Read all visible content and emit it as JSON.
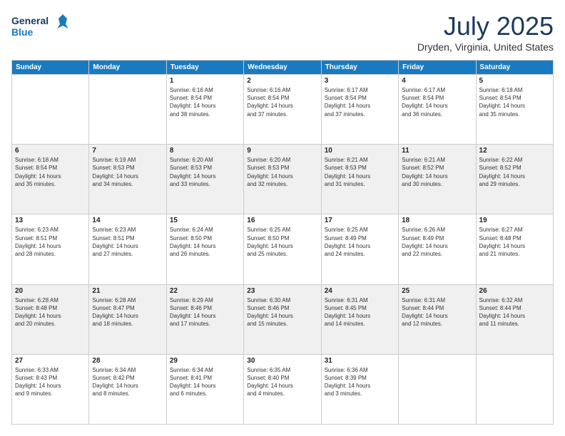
{
  "header": {
    "logo_line1": "General",
    "logo_line2": "Blue",
    "month_year": "July 2025",
    "location": "Dryden, Virginia, United States"
  },
  "weekdays": [
    "Sunday",
    "Monday",
    "Tuesday",
    "Wednesday",
    "Thursday",
    "Friday",
    "Saturday"
  ],
  "weeks": [
    [
      {
        "day": "",
        "info": ""
      },
      {
        "day": "",
        "info": ""
      },
      {
        "day": "1",
        "info": "Sunrise: 6:16 AM\nSunset: 8:54 PM\nDaylight: 14 hours\nand 38 minutes."
      },
      {
        "day": "2",
        "info": "Sunrise: 6:16 AM\nSunset: 8:54 PM\nDaylight: 14 hours\nand 37 minutes."
      },
      {
        "day": "3",
        "info": "Sunrise: 6:17 AM\nSunset: 8:54 PM\nDaylight: 14 hours\nand 37 minutes."
      },
      {
        "day": "4",
        "info": "Sunrise: 6:17 AM\nSunset: 8:54 PM\nDaylight: 14 hours\nand 36 minutes."
      },
      {
        "day": "5",
        "info": "Sunrise: 6:18 AM\nSunset: 8:54 PM\nDaylight: 14 hours\nand 35 minutes."
      }
    ],
    [
      {
        "day": "6",
        "info": "Sunrise: 6:18 AM\nSunset: 8:54 PM\nDaylight: 14 hours\nand 35 minutes."
      },
      {
        "day": "7",
        "info": "Sunrise: 6:19 AM\nSunset: 8:53 PM\nDaylight: 14 hours\nand 34 minutes."
      },
      {
        "day": "8",
        "info": "Sunrise: 6:20 AM\nSunset: 8:53 PM\nDaylight: 14 hours\nand 33 minutes."
      },
      {
        "day": "9",
        "info": "Sunrise: 6:20 AM\nSunset: 8:53 PM\nDaylight: 14 hours\nand 32 minutes."
      },
      {
        "day": "10",
        "info": "Sunrise: 6:21 AM\nSunset: 8:53 PM\nDaylight: 14 hours\nand 31 minutes."
      },
      {
        "day": "11",
        "info": "Sunrise: 6:21 AM\nSunset: 8:52 PM\nDaylight: 14 hours\nand 30 minutes."
      },
      {
        "day": "12",
        "info": "Sunrise: 6:22 AM\nSunset: 8:52 PM\nDaylight: 14 hours\nand 29 minutes."
      }
    ],
    [
      {
        "day": "13",
        "info": "Sunrise: 6:23 AM\nSunset: 8:51 PM\nDaylight: 14 hours\nand 28 minutes."
      },
      {
        "day": "14",
        "info": "Sunrise: 6:23 AM\nSunset: 8:51 PM\nDaylight: 14 hours\nand 27 minutes."
      },
      {
        "day": "15",
        "info": "Sunrise: 6:24 AM\nSunset: 8:50 PM\nDaylight: 14 hours\nand 26 minutes."
      },
      {
        "day": "16",
        "info": "Sunrise: 6:25 AM\nSunset: 8:50 PM\nDaylight: 14 hours\nand 25 minutes."
      },
      {
        "day": "17",
        "info": "Sunrise: 6:25 AM\nSunset: 8:49 PM\nDaylight: 14 hours\nand 24 minutes."
      },
      {
        "day": "18",
        "info": "Sunrise: 6:26 AM\nSunset: 8:49 PM\nDaylight: 14 hours\nand 22 minutes."
      },
      {
        "day": "19",
        "info": "Sunrise: 6:27 AM\nSunset: 8:48 PM\nDaylight: 14 hours\nand 21 minutes."
      }
    ],
    [
      {
        "day": "20",
        "info": "Sunrise: 6:28 AM\nSunset: 8:48 PM\nDaylight: 14 hours\nand 20 minutes."
      },
      {
        "day": "21",
        "info": "Sunrise: 6:28 AM\nSunset: 8:47 PM\nDaylight: 14 hours\nand 18 minutes."
      },
      {
        "day": "22",
        "info": "Sunrise: 6:29 AM\nSunset: 8:46 PM\nDaylight: 14 hours\nand 17 minutes."
      },
      {
        "day": "23",
        "info": "Sunrise: 6:30 AM\nSunset: 8:46 PM\nDaylight: 14 hours\nand 15 minutes."
      },
      {
        "day": "24",
        "info": "Sunrise: 6:31 AM\nSunset: 8:45 PM\nDaylight: 14 hours\nand 14 minutes."
      },
      {
        "day": "25",
        "info": "Sunrise: 6:31 AM\nSunset: 8:44 PM\nDaylight: 14 hours\nand 12 minutes."
      },
      {
        "day": "26",
        "info": "Sunrise: 6:32 AM\nSunset: 8:44 PM\nDaylight: 14 hours\nand 11 minutes."
      }
    ],
    [
      {
        "day": "27",
        "info": "Sunrise: 6:33 AM\nSunset: 8:43 PM\nDaylight: 14 hours\nand 9 minutes."
      },
      {
        "day": "28",
        "info": "Sunrise: 6:34 AM\nSunset: 8:42 PM\nDaylight: 14 hours\nand 8 minutes."
      },
      {
        "day": "29",
        "info": "Sunrise: 6:34 AM\nSunset: 8:41 PM\nDaylight: 14 hours\nand 6 minutes."
      },
      {
        "day": "30",
        "info": "Sunrise: 6:35 AM\nSunset: 8:40 PM\nDaylight: 14 hours\nand 4 minutes."
      },
      {
        "day": "31",
        "info": "Sunrise: 6:36 AM\nSunset: 8:39 PM\nDaylight: 14 hours\nand 3 minutes."
      },
      {
        "day": "",
        "info": ""
      },
      {
        "day": "",
        "info": ""
      }
    ]
  ]
}
